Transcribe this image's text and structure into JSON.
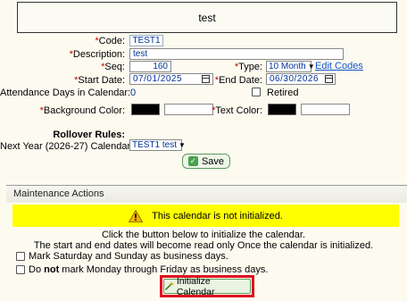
{
  "title": "test",
  "form": {
    "code_label": "*Code:",
    "code_value": "TEST1",
    "description_label": "*Description:",
    "description_value": "test",
    "seq_label": "*Seq:",
    "seq_value": "160",
    "type_label": "*Type:",
    "type_value": "10 Month",
    "edit_codes_link": "Edit Codes",
    "start_date_label": "*Start Date:",
    "start_date_value": "07/01/2025",
    "end_date_label": "*End Date:",
    "end_date_value": "06/30/2026",
    "attendance_days_label": "Attendance Days in Calendar:",
    "attendance_days_value": "0",
    "retired_label": "Retired",
    "background_color_label": "*Background Color:",
    "text_color_label": "*Text Color:",
    "swatch_color": "#000000",
    "rollover_heading": "Rollover Rules:",
    "next_year_label": "Next Year (2026-27) Calendar:",
    "next_year_value": "TEST1 test",
    "save_label": "Save"
  },
  "maintenance": {
    "header": "Maintenance Actions",
    "warning": "This calendar is not initialized.",
    "instruction_1": "Click the button below to initialize the calendar.",
    "instruction_2": "The start and end dates will become read only Once the calendar is initialized.",
    "option_weekends": "Mark Saturday and Sunday as business days.",
    "option_weekdays_pre": "Do ",
    "option_weekdays_bold": "not",
    "option_weekdays_post": " mark Monday through Friday as business days.",
    "initialize_label": "Initialize Calendar"
  },
  "colors": {
    "warning_bg": "#ffff00",
    "highlight_outline": "#e01020",
    "required": "#cc0000"
  },
  "icons": {
    "warning": "warning-triangle-icon",
    "save": "save-check-icon",
    "initialize": "wand-icon",
    "date": "calendar-icon"
  }
}
